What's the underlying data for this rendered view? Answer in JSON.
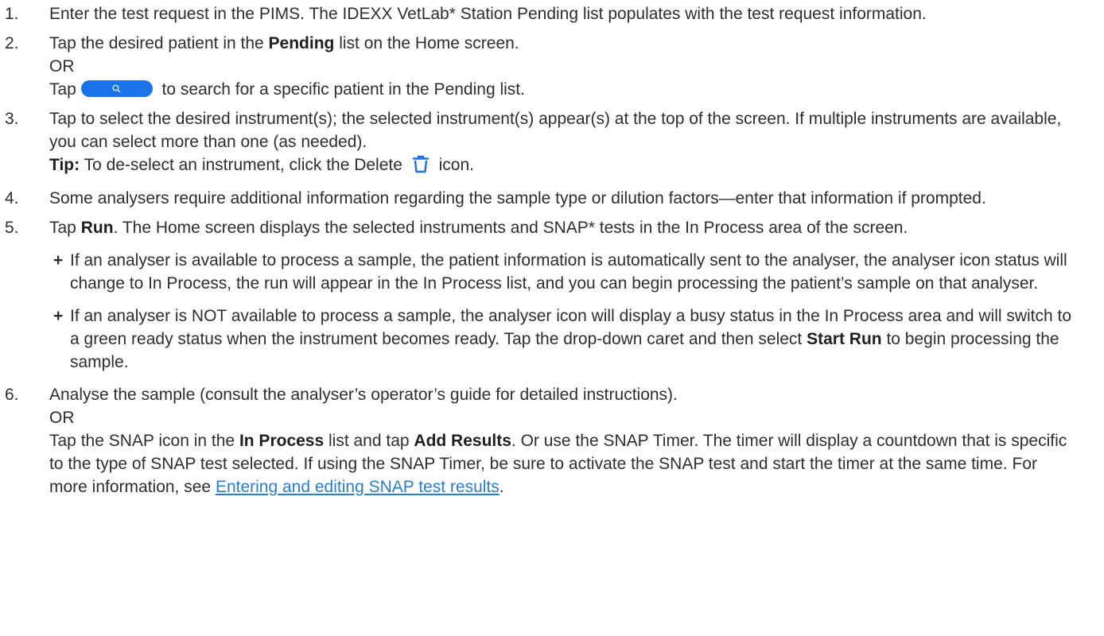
{
  "steps": [
    {
      "num": "1.",
      "text": "Enter the test request in the PIMS. The IDEXX VetLab* Station Pending list populates with the test request information."
    },
    {
      "num": "2.",
      "a_pre": "Tap the desired patient in the ",
      "a_bold": "Pending",
      "a_post": " list on the Home screen.",
      "or": "OR",
      "b_pre": "Tap ",
      "b_post": " to search for a specific patient in the Pending list."
    },
    {
      "num": "3.",
      "text": "Tap to select the desired instrument(s); the selected instrument(s) appear(s) at the top of the screen. If multiple instruments are available, you can select more than one (as needed).",
      "tip_label": "Tip:",
      "tip_pre": " To de-select an instrument, click the Delete ",
      "tip_post": " icon."
    },
    {
      "num": "4.",
      "text": "Some analysers require additional information regarding the sample type or dilution factors—enter that information if prompted."
    },
    {
      "num": "5.",
      "pre": "Tap ",
      "bold": "Run",
      "post": ". The Home screen displays the selected instruments and SNAP* tests in the In Process area of the screen.",
      "bullets": [
        {
          "text": "If an analyser is available to process a sample, the patient information is automatically sent to the analyser, the analyser icon status will change to In Process, the run will appear in the In Process list, and you can begin processing the patient’s sample on that analyser."
        },
        {
          "pre": "If an analyser is NOT available to process a sample, the analyser icon will display a busy status in the In Process area and will switch to a green ready status when the instrument becomes ready. Tap the drop-down caret and then select ",
          "bold": "Start Run",
          "post": " to begin processing the sample."
        }
      ]
    },
    {
      "num": "6.",
      "line1": "Analyse the sample (consult the analyser’s operator’s guide for detailed instructions).",
      "or": "OR",
      "p_pre": "Tap the SNAP icon in the ",
      "p_bold1": "In Process",
      "p_mid": " list and tap ",
      "p_bold2": "Add Results",
      "p_post": ". Or use the SNAP Timer. The timer will display a countdown that is specific to the type of SNAP test selected. If using the SNAP Timer, be sure to activate the SNAP test and start the timer at the same time. For more information, see ",
      "link": "Entering and editing SNAP test results",
      "end": "."
    }
  ],
  "icons": {
    "search_button": "search-icon",
    "delete": "trash-icon"
  },
  "colors": {
    "accent": "#1a73e8",
    "link": "#2a7fc7",
    "text": "#2e2e2e"
  }
}
